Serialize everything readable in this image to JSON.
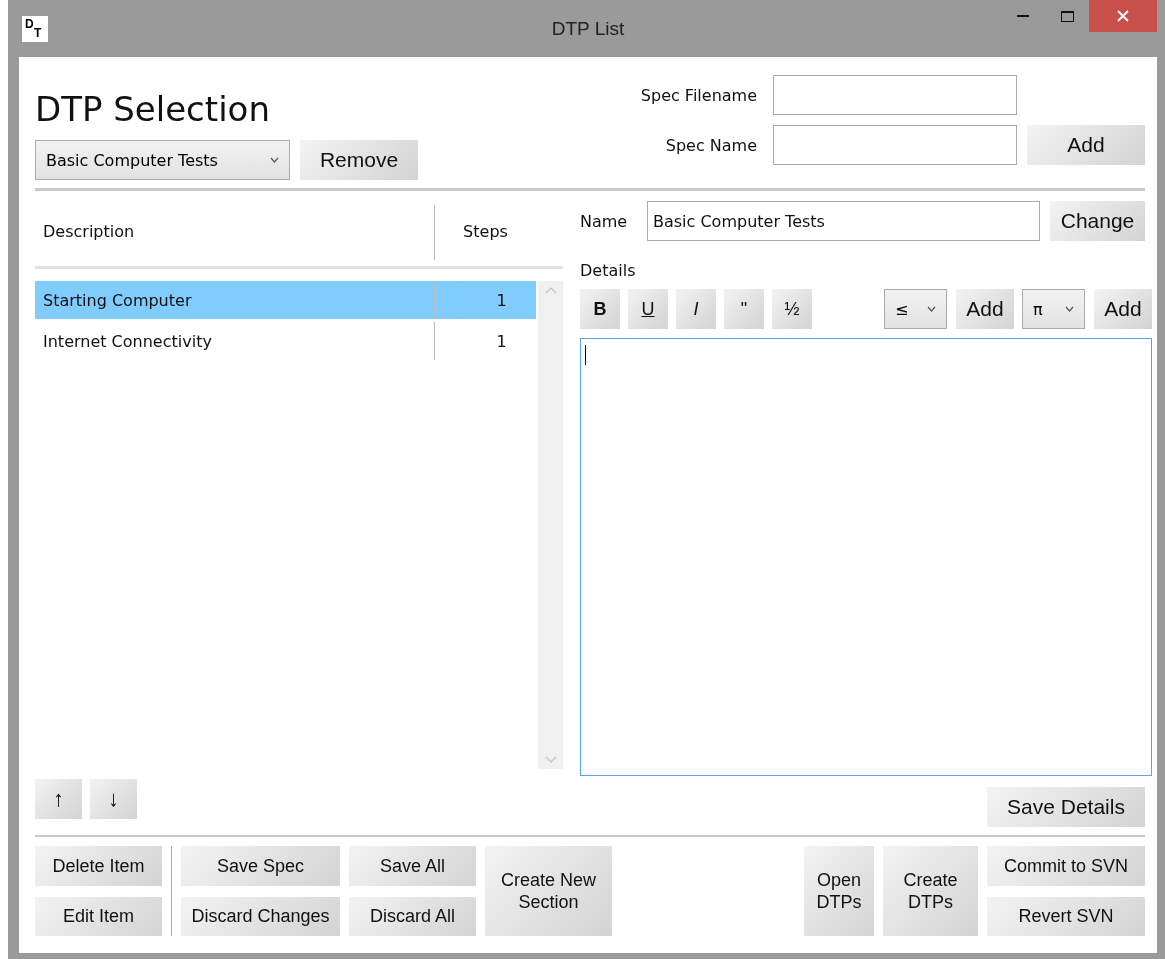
{
  "window": {
    "title": "DTP List",
    "logo": [
      "D",
      "T"
    ]
  },
  "header": {
    "heading": "DTP Selection",
    "spec_dropdown": {
      "value": "Basic Computer Tests"
    },
    "remove_button": "Remove",
    "fields": [
      {
        "label": "Spec Filename"
      },
      {
        "label": "Spec Name"
      }
    ],
    "add_button": "Add"
  },
  "list": {
    "columns": [
      "Description",
      "Steps"
    ],
    "rows": [
      {
        "description": "Starting Computer",
        "steps": "1",
        "selected": true
      },
      {
        "description": "Internet Connectivity",
        "steps": "1",
        "selected": false
      }
    ]
  },
  "move_buttons": [
    "↑",
    "↓"
  ],
  "editor": {
    "name_label": "Name",
    "name_value": "Basic Computer Tests",
    "change_button": "Change",
    "details_label": "Details",
    "format_buttons": [
      {
        "label": "B",
        "kind": "bold"
      },
      {
        "label": "U",
        "kind": "underline"
      },
      {
        "label": "I",
        "kind": "italic"
      },
      {
        "label": "\"",
        "kind": "plain"
      },
      {
        "label": "½",
        "kind": "plain"
      }
    ],
    "symbol_pickers": [
      {
        "value": "≤",
        "add_button": "Add"
      },
      {
        "value": "π",
        "add_button": "Add"
      }
    ],
    "focused": true,
    "save_button": "Save Details"
  },
  "bottom_bar": {
    "left": [
      {
        "kind": "buttons",
        "buttons": [
          "Delete Item",
          "Edit Item"
        ]
      },
      {
        "kind": "divider"
      },
      {
        "kind": "buttons",
        "buttons": [
          "Save Spec",
          "Discard Changes"
        ]
      },
      {
        "kind": "buttons",
        "buttons": [
          "Save All",
          "Discard All"
        ]
      },
      {
        "kind": "buttons",
        "buttons": [
          "Create New Section"
        ]
      }
    ],
    "right": [
      {
        "kind": "buttons",
        "buttons": [
          "Open DTPs"
        ]
      },
      {
        "kind": "buttons",
        "buttons": [
          "Create DTPs"
        ]
      },
      {
        "kind": "buttons",
        "buttons": [
          "Commit to SVN",
          "Revert SVN"
        ]
      }
    ]
  }
}
